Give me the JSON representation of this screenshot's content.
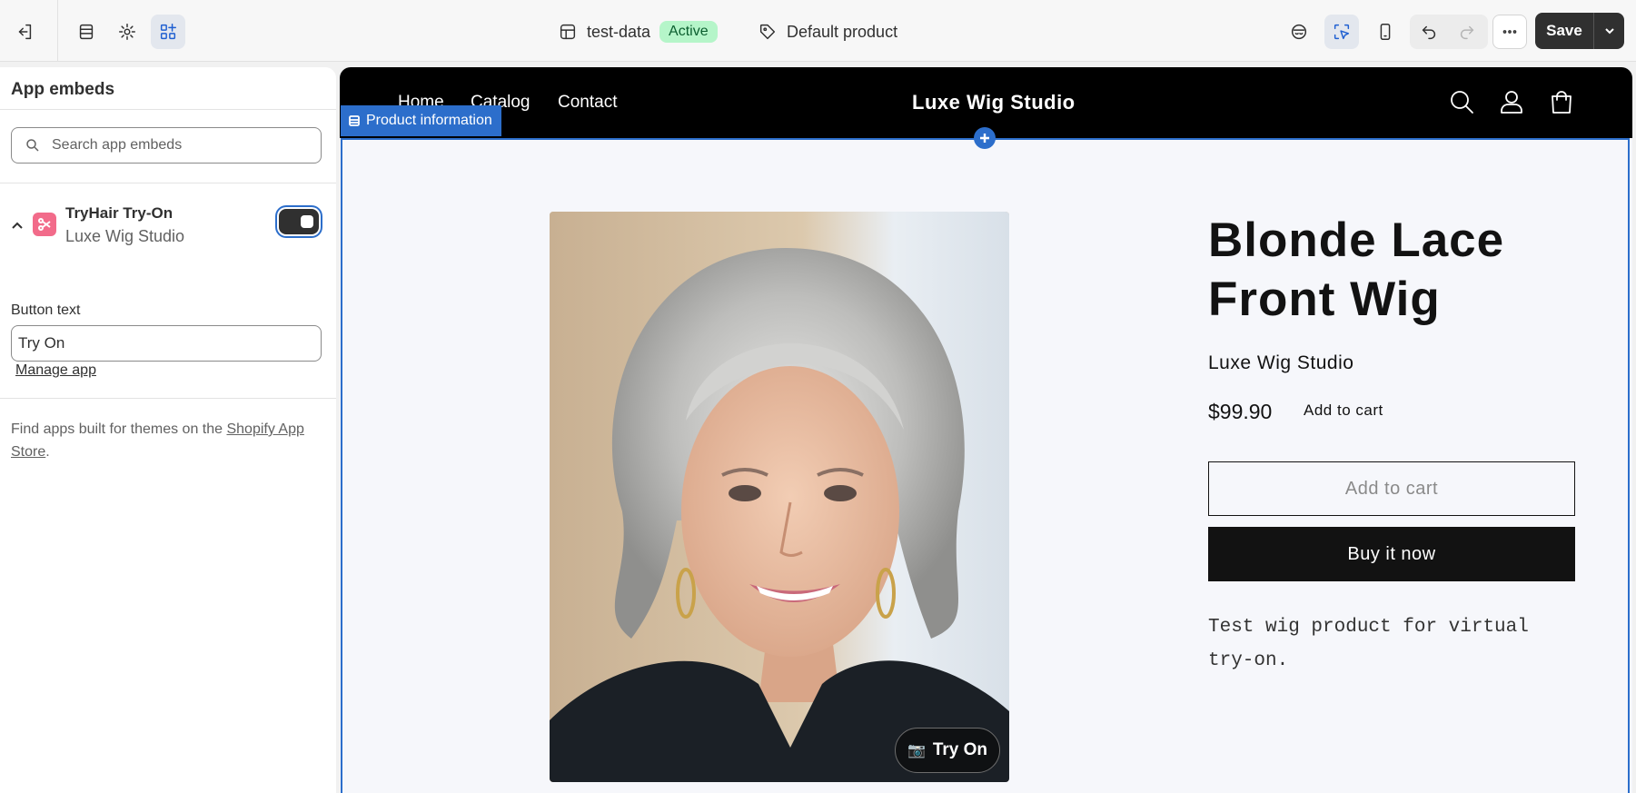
{
  "topbar": {
    "theme_name": "test-data",
    "theme_status": "Active",
    "template_name": "Default product",
    "save_label": "Save"
  },
  "sidebar": {
    "title": "App embeds",
    "search_placeholder": "Search app embeds",
    "embed": {
      "name": "TryHair Try-On",
      "store": "Luxe Wig Studio",
      "enabled": true
    },
    "button_text_label": "Button text",
    "button_text_value": "Try On",
    "manage_link": "Manage app",
    "find_apps_text": "Find apps built for themes on the",
    "find_apps_link": "Shopify App Store",
    "find_apps_end": "."
  },
  "store": {
    "nav": [
      "Home",
      "Catalog",
      "Contact"
    ],
    "name": "Luxe Wig Studio",
    "section_tag": "Product information",
    "product": {
      "title": "Blonde Lace Front Wig",
      "vendor": "Luxe Wig Studio",
      "price": "$99.90",
      "price_note": "Add to cart",
      "add_to_cart": "Add to cart",
      "buy_now": "Buy it now",
      "description": "Test wig product for virtual try-on.",
      "try_on_label": "Try On"
    }
  },
  "colors": {
    "accent": "#2c6ecb",
    "active_badge": "#b5f5c9",
    "app_icon": "#f26b8a"
  }
}
